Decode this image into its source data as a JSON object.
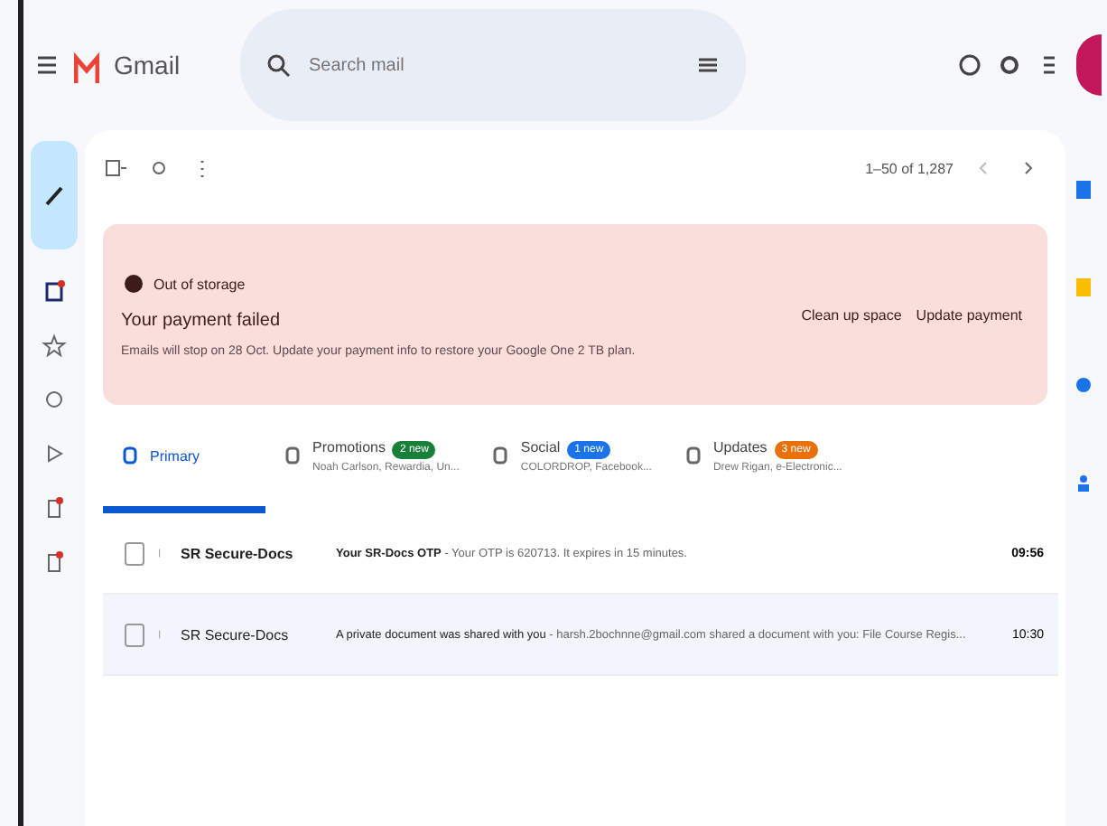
{
  "app": {
    "name": "Gmail"
  },
  "search": {
    "placeholder": "Search mail"
  },
  "toolbar": {
    "pagination": "1–50 of 1,287",
    "select_all_checked": false
  },
  "banner": {
    "label": "Out of storage",
    "title": "Your payment failed",
    "message": "Emails will stop on 28 Oct. Update your payment info to restore your Google One 2 TB plan.",
    "actions": [
      "Clean up space",
      "Update payment"
    ]
  },
  "tabs": [
    {
      "label": "Primary",
      "selected": true
    },
    {
      "label": "Promotions",
      "selected": false,
      "badge": "2 new",
      "color": "#188038",
      "snippet": "Noah Carlson, Rewardia, Un..."
    },
    {
      "label": "Social",
      "selected": false,
      "badge": "1 new",
      "color": "#1a73e8",
      "snippet": "COLORDROP, Facebook..."
    },
    {
      "label": "Updates",
      "selected": false,
      "badge": "3 new",
      "color": "#e8710a",
      "snippet": "Drew Rigan, e-Electronic..."
    }
  ],
  "emails": [
    {
      "sender": "SR Secure-Docs",
      "subject": "Your SR-Docs OTP",
      "preview": " - Your OTP is 620713. It expires in 15 minutes.",
      "time": "09:56",
      "unread": true,
      "checked": false
    },
    {
      "sender": "SR Secure-Docs",
      "subject": "A private document was shared with you",
      "preview": " - harsh.2bochnne@gmail.com shared a document with you: File Course Regis...",
      "time": "10:30",
      "unread": false,
      "checked": false
    }
  ]
}
